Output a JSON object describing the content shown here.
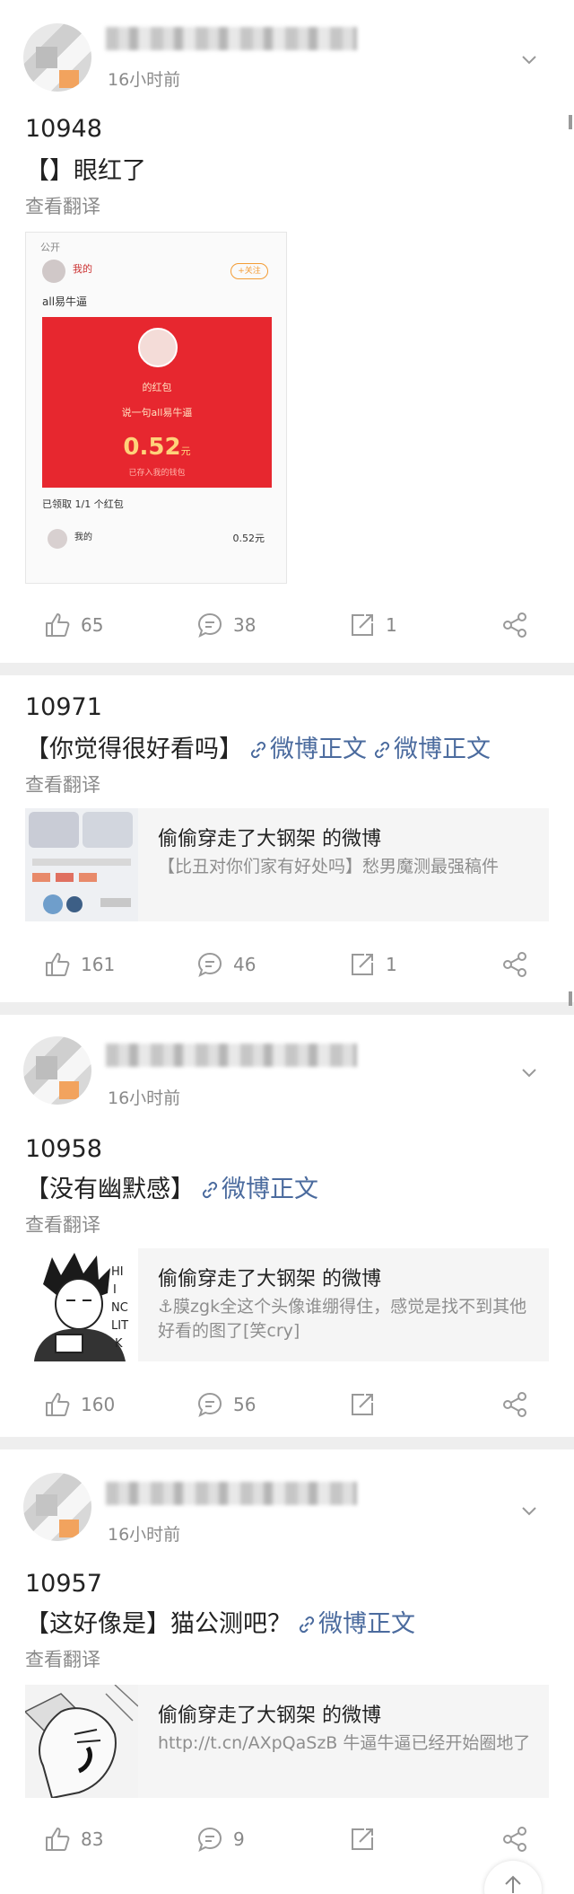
{
  "posts": [
    {
      "time": "16小时前",
      "number": "10948",
      "text": "【】眼红了",
      "translate": "查看翻译",
      "screenshot": {
        "public_label": "公开",
        "name": "我的",
        "follow": "+关注",
        "body": "all易牛逼",
        "packet_title": "的红包",
        "packet_greeting": "说一句all易牛逼",
        "amount": "0.52",
        "amount_unit": "元",
        "sub": "已存入我的钱包",
        "received": "已领取 1/1 个红包",
        "receiver_name": "我的",
        "receiver_amount": "0.52元"
      },
      "likes": "65",
      "comments": "38",
      "reposts": "1"
    },
    {
      "number": "10971",
      "text": "【你觉得很好看吗】",
      "links": [
        "微博正文",
        "微博正文"
      ],
      "translate": "查看翻译",
      "quote_title": "偷偷穿走了大钢架 的微博",
      "quote_text": "【比丑对你们家有好处吗】愁男魔测最强稿件",
      "likes": "161",
      "comments": "46",
      "reposts": "1"
    },
    {
      "time": "16小时前",
      "number": "10958",
      "text": "【没有幽默感】",
      "links": [
        "微博正文"
      ],
      "translate": "查看翻译",
      "quote_title": "偷偷穿走了大钢架 的微博",
      "quote_text": "⚓膜zgk全这个头像谁绷得住，感觉是找不到其他好看的图了[笑cry]",
      "likes": "160",
      "comments": "56",
      "reposts": ""
    },
    {
      "time": "16小时前",
      "number": "10957",
      "text": "【这好像是】猫公测吧？",
      "links": [
        "微博正文"
      ],
      "translate": "查看翻译",
      "quote_title": "偷偷穿走了大钢架 的微博",
      "quote_text": "http://t.cn/AXpQaSzB 牛逼牛逼已经开始圈地了",
      "likes": "83",
      "comments": "9",
      "reposts": ""
    }
  ],
  "colors": {
    "link": "#4b6b9e",
    "red_packet": "#e7272f"
  }
}
